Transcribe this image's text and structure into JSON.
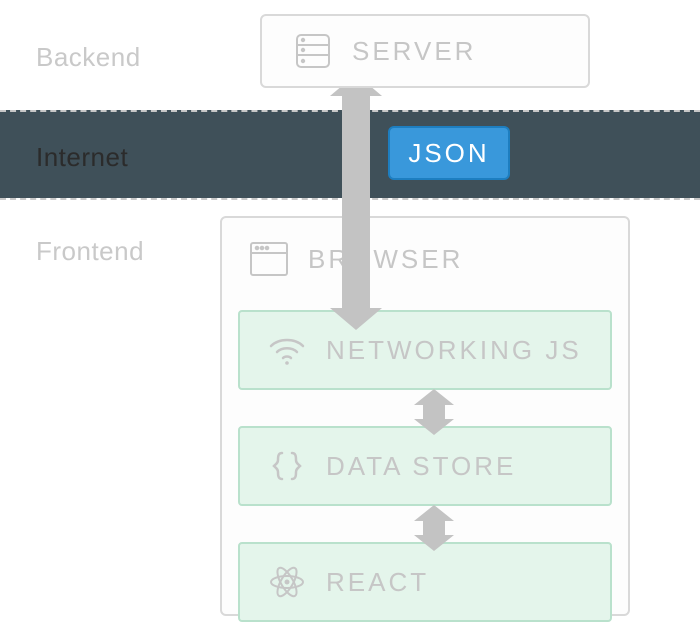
{
  "labels": {
    "backend": "Backend",
    "internet": "Internet",
    "frontend": "Frontend"
  },
  "server": {
    "title": "SERVER"
  },
  "json_badge": "JSON",
  "browser": {
    "title": "BROWSER",
    "networking": "NETWORKING JS",
    "datastore": "DATA STORE",
    "react": "REACT"
  }
}
